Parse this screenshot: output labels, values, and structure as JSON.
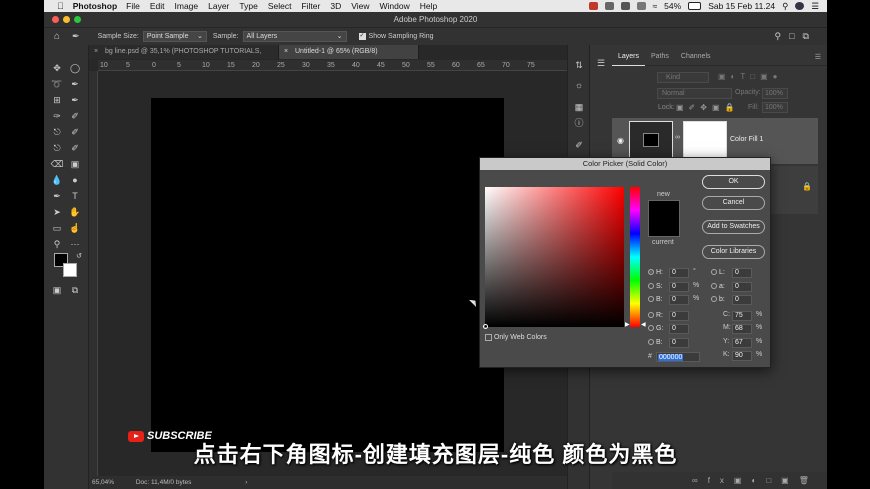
{
  "menubar": {
    "app_name": "Photoshop",
    "items": [
      "File",
      "Edit",
      "Image",
      "Layer",
      "Type",
      "Select",
      "Filter",
      "3D",
      "View",
      "Window",
      "Help"
    ],
    "battery": "54%",
    "clock": "Sab 15 Feb  11.24"
  },
  "titlebar": {
    "title": "Adobe Photoshop 2020"
  },
  "options": {
    "sample_size_label": "Sample Size:",
    "sample_size_value": "Point Sample",
    "sample_label": "Sample:",
    "sample_value": "All Layers",
    "show_ring_label": "Show Sampling Ring"
  },
  "tabs": [
    {
      "label": "bg line.psd @ 35,1% (PHOTOSHOP TUTORIALS, RGB/8) *"
    },
    {
      "label": "Untitled-1 @ 65% (RGB/8)"
    }
  ],
  "ruler": {
    "ticks": [
      "10",
      "5",
      "0",
      "5",
      "10",
      "15",
      "20",
      "25",
      "30",
      "35",
      "40",
      "45",
      "50",
      "55",
      "60",
      "65",
      "70",
      "75"
    ]
  },
  "status": {
    "zoom": "65,04%",
    "doc": "Doc: 11,4M/0 bytes"
  },
  "layers_panel": {
    "tabs": [
      "Layers",
      "Paths",
      "Channels"
    ],
    "kind_label": "Kind",
    "blend_mode": "Normal",
    "opacity_label": "Opacity:",
    "opacity_value": "100%",
    "lock_label": "Lock:",
    "fill_label": "Fill:",
    "fill_value": "100%",
    "layer_name": "Color Fill 1"
  },
  "color_picker": {
    "title": "Color Picker (Solid Color)",
    "new_label": "new",
    "current_label": "current",
    "ok_label": "OK",
    "cancel_label": "Cancel",
    "add_swatches_label": "Add to Swatches",
    "libraries_label": "Color Libraries",
    "only_web_label": "Only Web Colors",
    "hsb": [
      {
        "label": "H:",
        "value": "0",
        "unit": "°"
      },
      {
        "label": "S:",
        "value": "0",
        "unit": "%"
      },
      {
        "label": "B:",
        "value": "0",
        "unit": "%"
      }
    ],
    "rgb": [
      {
        "label": "R:",
        "value": "0"
      },
      {
        "label": "G:",
        "value": "0"
      },
      {
        "label": "B:",
        "value": "0"
      }
    ],
    "lab": [
      {
        "label": "L:",
        "value": "0"
      },
      {
        "label": "a:",
        "value": "0"
      },
      {
        "label": "b:",
        "value": "0"
      }
    ],
    "cmyk": [
      {
        "label": "C:",
        "value": "75",
        "unit": "%"
      },
      {
        "label": "M:",
        "value": "68",
        "unit": "%"
      },
      {
        "label": "Y:",
        "value": "67",
        "unit": "%"
      },
      {
        "label": "K:",
        "value": "90",
        "unit": "%"
      }
    ],
    "hex_label": "#",
    "hex_value": "000000",
    "hue_color": "#ff0000"
  },
  "overlay": {
    "subscribe": "SUBSCRIBE",
    "subtitle": "点击右下角图标-创建填充图层-纯色 颜色为黑色"
  }
}
